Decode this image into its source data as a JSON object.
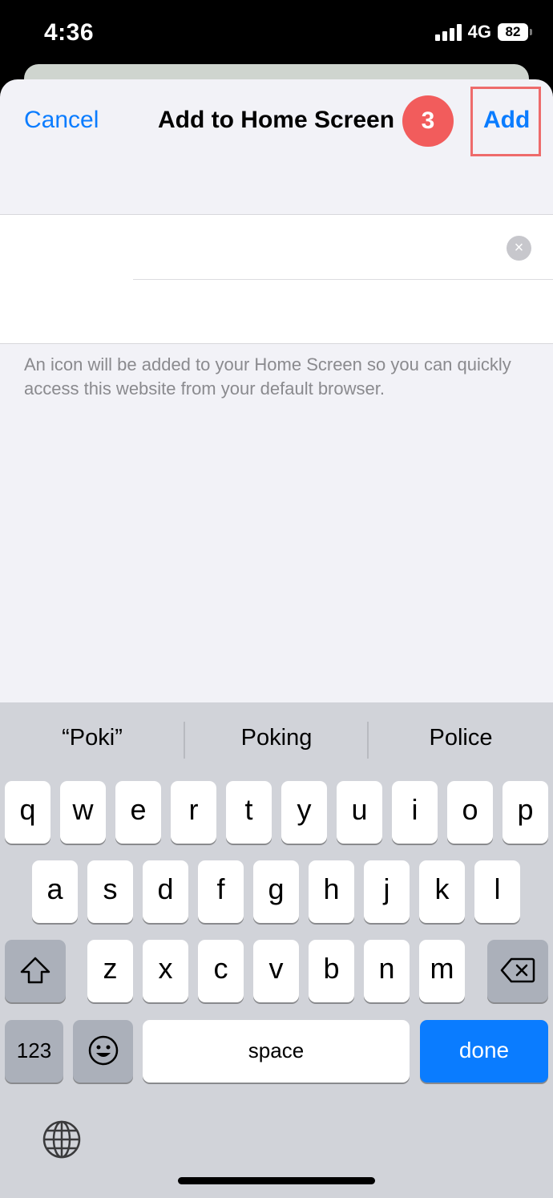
{
  "status_bar": {
    "time": "4:36",
    "network": "4G",
    "battery": "82"
  },
  "nav": {
    "cancel": "Cancel",
    "title": "Add to Home Screen",
    "step_badge": "3",
    "add": "Add"
  },
  "form": {
    "clear_icon": "×",
    "helper_text": "An icon will be added to your Home Screen so you can quickly access this website from your default browser."
  },
  "keyboard": {
    "suggestions": [
      "“Poki”",
      "Poking",
      "Police"
    ],
    "row1": [
      "q",
      "w",
      "e",
      "r",
      "t",
      "y",
      "u",
      "i",
      "o",
      "p"
    ],
    "row2": [
      "a",
      "s",
      "d",
      "f",
      "g",
      "h",
      "j",
      "k",
      "l"
    ],
    "row3": [
      "z",
      "x",
      "c",
      "v",
      "b",
      "n",
      "m"
    ],
    "numbers_key": "123",
    "space_key": "space",
    "done_key": "done"
  },
  "colors": {
    "accent": "#0a7cff",
    "badge": "#f25c5c",
    "highlight": "#ee6b6b"
  }
}
